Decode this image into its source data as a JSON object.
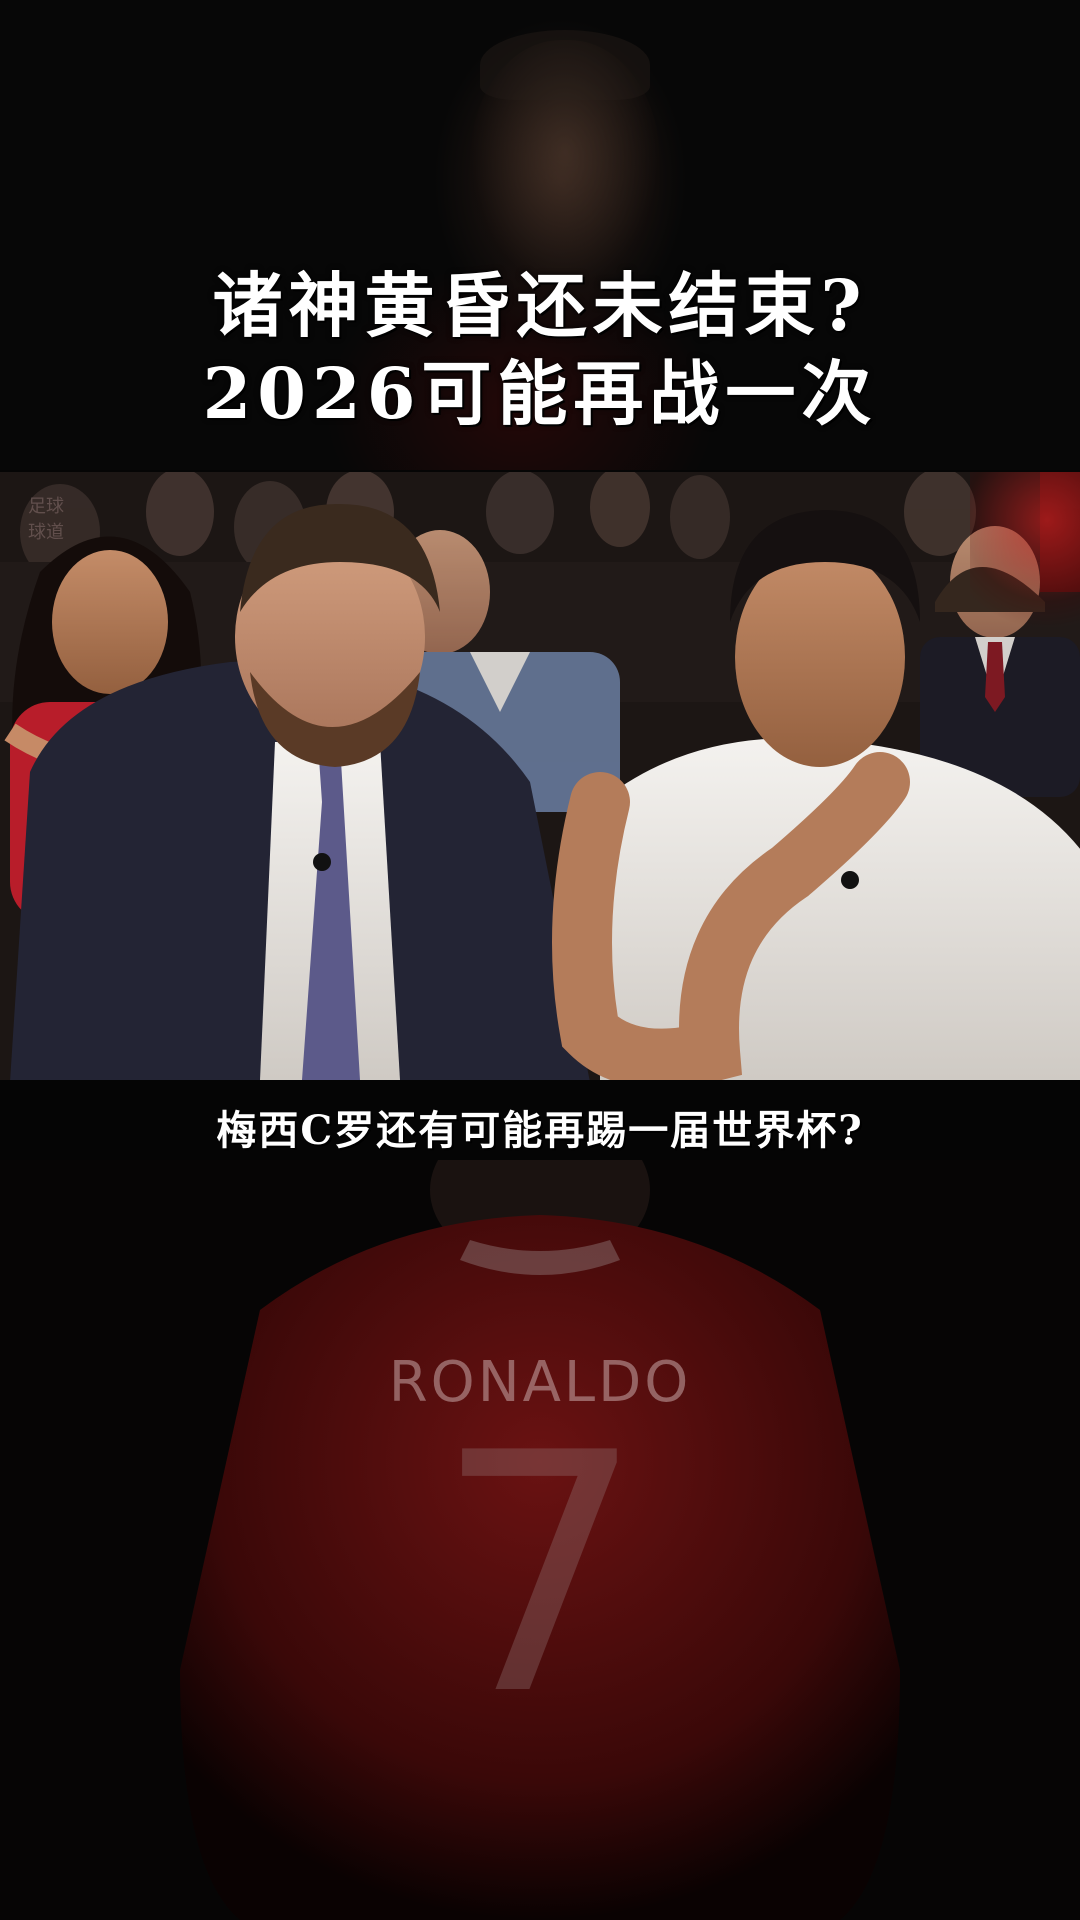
{
  "title": {
    "line1": "诸神黄昏还未结束?",
    "line2": "2026可能再战一次"
  },
  "video": {
    "watermark_line1": "足球",
    "watermark_line2": "球道"
  },
  "caption": "梅西C罗还有可能再踢一届世界杯?",
  "background": {
    "jersey_name": "RONALDO",
    "jersey_number": "7"
  },
  "colors": {
    "text": "#ffffff",
    "jersey": "#6a1212",
    "background": "#050505"
  }
}
